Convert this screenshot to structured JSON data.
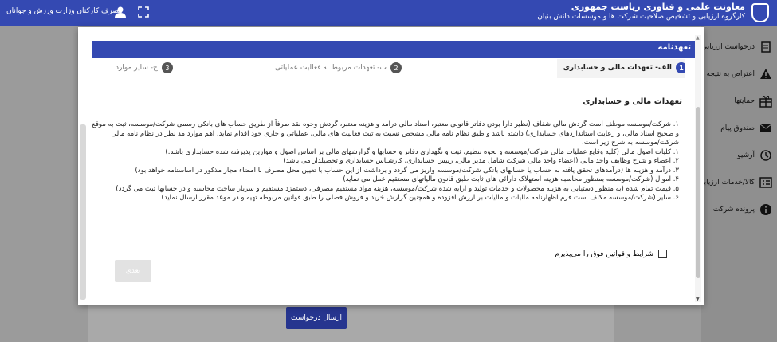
{
  "topbar": {
    "title": "معاونت علمی و فناوری ریاست جمهوری",
    "subtitle": "کارگروه ارزیابی و تشخیص صلاحیت شرکت ها و موسسات دانش بنیان",
    "user_name": "مصرف کارکنان وزارت ورزش و جوانان"
  },
  "sidebar": {
    "items": [
      {
        "label": "درخواست ارزیابی",
        "icon": "request-icon"
      },
      {
        "label": "اعتراض به نتیجه",
        "icon": "warning-icon"
      },
      {
        "label": "حمایتها",
        "icon": "gift-icon"
      },
      {
        "label": "صندوق پیام",
        "icon": "mail-icon"
      },
      {
        "label": "آرشیو",
        "icon": "history-icon"
      },
      {
        "label": "کالا/خدمات ارزیابی",
        "icon": "list-icon"
      },
      {
        "label": "پرونده شرکت",
        "icon": "info-icon"
      }
    ]
  },
  "modal": {
    "header": "تعهدنامه",
    "steps": [
      {
        "num": "1",
        "label": "الف- تعهدات مالی و حسابداری",
        "active": true
      },
      {
        "num": "2",
        "label": "ب- تعهدات مربوط به فعالیت عملیاتی",
        "active": false
      },
      {
        "num": "3",
        "label": "ج- سایر موارد",
        "active": false
      }
    ],
    "section_title": "تعهدات مالی و حسابداری",
    "intro": "۱. شرکت/موسسه موظف است گردش مالی شفاف (نظیر دارا بودن دفاتر قانونی معتبر، اسناد مالی درآمد و هزینه معتبر، گردش وجوه نقد صرفاً از طریق حساب های بانکی رسمی شرکت/موسسه، ثبت به موقع و صحیح اسناد مالی، و رعایت استانداردهای حسابداری) داشته باشد و طبق نظام نامه مالی مشخص نسبت به ثبت فعالیت های مالی، عملیاتی و جاری خود اقدام نماید. اهم موارد مد نظر در نظام نامه مالی شرکت/موسسه به شرح زیر است.",
    "items": [
      "۱. کلیات اصول مالی (کلیه وقایع عملیات مالی شرکت/موسسه و نحوه تنظیم، ثبت و نگهداری دفاتر و حسابها و گزارشهای مالی بر اساس اصول و موازین پذیرفته شده حسابداری باشد.)",
      "۲. اعضاء و شرح وظایف واحد مالی (اعضاء واحد مالی شرکت شامل مدیر مالی، رییس حسابداری، کارشناس حسابداری و تحصیلدار می باشد)",
      "۳. درآمد و هزینه ها (درآمدهای تحقق یافته به حساب یا حسابهای بانکی شرکت/موسسه واریز می گردد و برداشت از این حساب با تعیین محل مصرف با امضاء مجاز مذکور در اساسنامه خواهد بود)",
      "۴. اموال (شرکت/موسسه بمنظور محاسبه هزینه استهلاک دارائی های ثابت طبق قانون مالیاتهای مستقیم عمل می نماید)",
      "۵. قیمت تمام شده (به منظور دستیابی به هزینه محصولات و خدمات تولید و ارایه شده شرکت/موسسه، هزینه مواد مستقیم مصرفی، دستمزد مستقیم و سربار ساخت محاسبه و در حسابها ثبت می گردد)",
      "۶. سایر (شرکت/موسسه مکلف است فرم اظهارنامه مالیات و مالیات بر ارزش افزوده و همچنین گزارش خرید و فروش فصلی را طبق قوانین مربوطه تهیه و در موعد مقرر ارسال نماید)"
    ],
    "agree_label": "شرایط و قوانین فوق را می‌پذیرم",
    "next_label": "بعدی"
  },
  "page": {
    "send_label": "ارسال درخواست"
  }
}
